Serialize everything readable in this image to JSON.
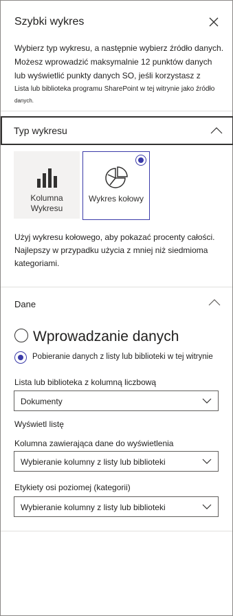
{
  "panel": {
    "title": "Szybki wykres",
    "intro_line1": "Wybierz typ wykresu, a następnie wybierz źródło danych. Możesz wprowadzić maksymalnie 12 punktów danych lub wyświetlić punkty danych SO, jeśli korzystasz z",
    "intro_line2": "Lista lub biblioteka programu SharePoint w tej witrynie jako źródło",
    "intro_line3": "danych."
  },
  "chart_type": {
    "section_title": "Typ wykresu",
    "options": [
      {
        "label_line1": "Kolumna",
        "label_line2": "Wykresu",
        "icon": "column-chart-icon",
        "selected": false
      },
      {
        "label": "Wykres kołowy",
        "icon": "pie-chart-icon",
        "selected": true
      }
    ],
    "description": "Użyj wykresu kołowego, aby pokazać procenty całości. Najlepszy w przypadku użycia z mniej niż siedmioma kategoriami."
  },
  "data": {
    "section_title": "Dane",
    "source_options": [
      {
        "label": "Wprowadzanie danych",
        "selected": false
      },
      {
        "label": "Pobieranie danych z listy lub biblioteki w tej witrynie",
        "selected": true
      }
    ],
    "list_label": "Lista lub biblioteka z kolumną liczbową",
    "list_value": "Dokumenty",
    "show_list_link": "Wyświetl listę",
    "column_label": "Kolumna zawierająca dane do wyświetlenia",
    "column_value": "Wybieranie kolumny z listy lub biblioteki",
    "axis_label": "Etykiety osi poziomej (kategorii)",
    "axis_value": "Wybieranie kolumny z listy lub biblioteki"
  },
  "colors": {
    "accent": "#3a3aa8",
    "text": "#201f1e",
    "border": "#605e5c"
  }
}
